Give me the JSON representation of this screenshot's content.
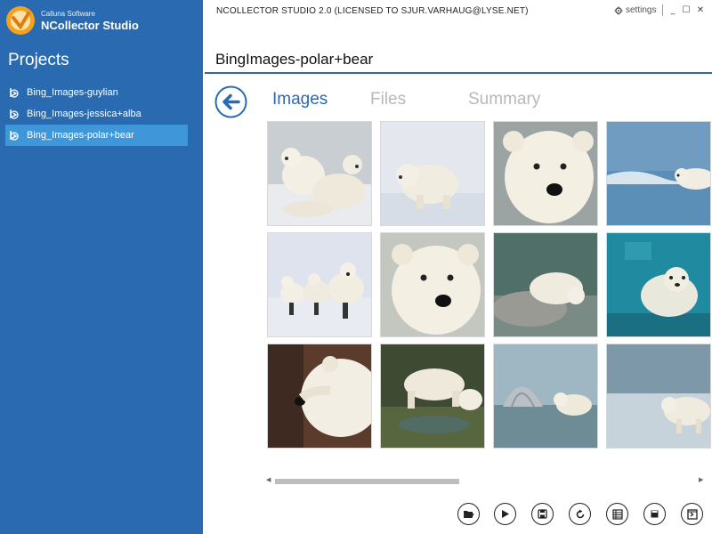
{
  "sidebar": {
    "brand_small": "Calluna Software",
    "brand_big": "NCollector Studio",
    "title": "Projects",
    "items": [
      {
        "label": "Bing_Images-guylian",
        "selected": false
      },
      {
        "label": "Bing_Images-jessica+alba",
        "selected": false
      },
      {
        "label": "Bing_Images-polar+bear",
        "selected": true
      }
    ]
  },
  "header": {
    "app_title": "NCOLLECTOR STUDIO 2.0 (LICENSED TO SJUR.VARHAUG@LYSE.NET)",
    "settings_label": "settings",
    "minimize": "_",
    "maximize": "☐",
    "close": "✕"
  },
  "project": {
    "title": "BingImages-polar+bear"
  },
  "tabs": [
    {
      "label": "Images",
      "active": true
    },
    {
      "label": "Files",
      "active": false
    },
    {
      "label": "Summary",
      "active": false
    }
  ],
  "colors": {
    "accent": "#2a6ab0",
    "selected": "#3f96d8",
    "tab_inactive": "#b8b8b8"
  },
  "thumbnails": [
    {
      "scene": "two polar bears sitting on snow"
    },
    {
      "scene": "polar bear walking on snow"
    },
    {
      "scene": "polar bear face close-up"
    },
    {
      "scene": "polar bear swimming in sea"
    },
    {
      "scene": "polar bear mother with cubs"
    },
    {
      "scene": "polar bear face close-up"
    },
    {
      "scene": "polar bear resting on rock"
    },
    {
      "scene": "polar bear swimming underwater"
    },
    {
      "scene": "polar bear head profile"
    },
    {
      "scene": "polar bear drinking from water"
    },
    {
      "scene": "polar bear by igloo"
    },
    {
      "scene": "polar bear walking on ice"
    }
  ],
  "scrollbar": {
    "left_arrow": "◀",
    "right_arrow": "▶",
    "position": 0.0
  },
  "toolbar": [
    {
      "icon": "open-folder-icon"
    },
    {
      "icon": "play-icon"
    },
    {
      "icon": "save-icon"
    },
    {
      "icon": "refresh-icon"
    },
    {
      "icon": "list-icon"
    },
    {
      "icon": "stop-icon"
    },
    {
      "icon": "export-icon"
    }
  ]
}
